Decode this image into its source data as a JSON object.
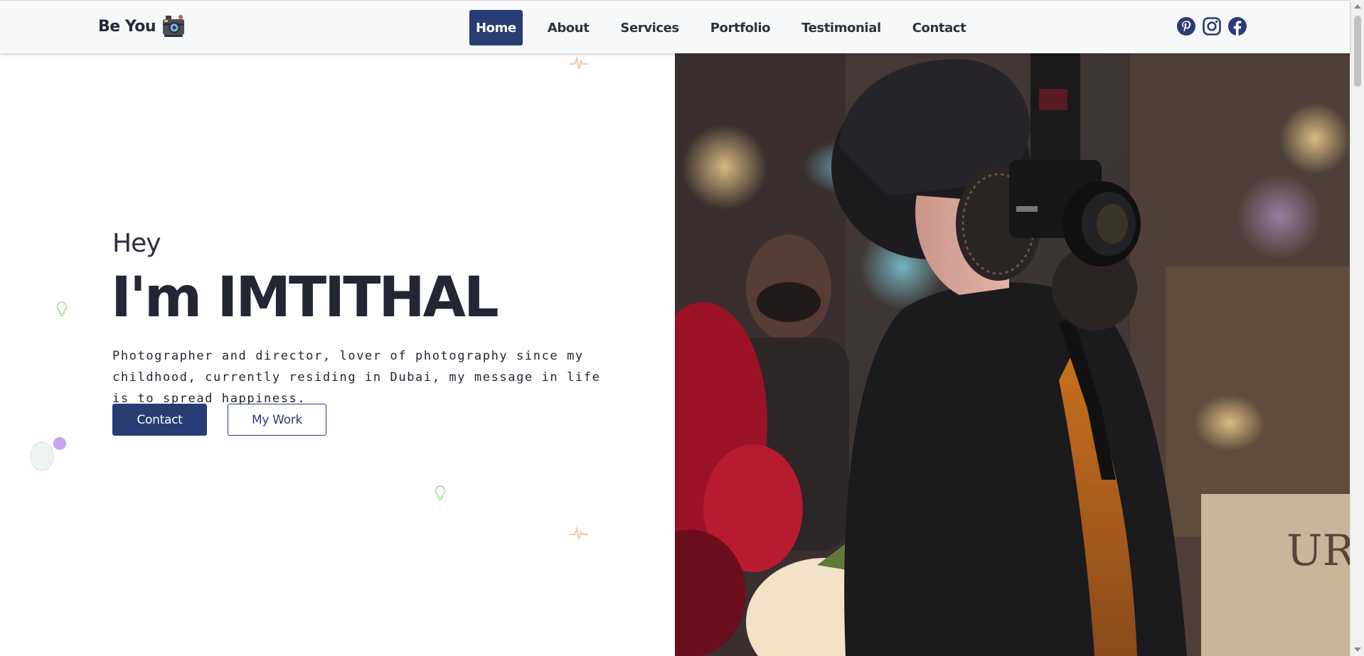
{
  "brand": {
    "name": "Be You",
    "logo_icon": "camera-icon"
  },
  "nav": {
    "items": [
      {
        "label": "Home",
        "active": true
      },
      {
        "label": "About",
        "active": false
      },
      {
        "label": "Services",
        "active": false
      },
      {
        "label": "Portfolio",
        "active": false
      },
      {
        "label": "Testimonial",
        "active": false
      },
      {
        "label": "Contact",
        "active": false
      }
    ]
  },
  "socials": [
    "pinterest-icon",
    "instagram-icon",
    "facebook-icon"
  ],
  "hero": {
    "greeting": "Hey",
    "name": "I'm IMTITHAL",
    "bio": "Photographer and director, lover of photography since my childhood, currently residing in Dubai, my message in life is to spread happiness.",
    "buttons": {
      "contact": "Contact",
      "work": "My Work"
    }
  },
  "colors": {
    "accent": "#283d73",
    "text": "#222733",
    "navbar_bg": "#f7f8fa"
  }
}
